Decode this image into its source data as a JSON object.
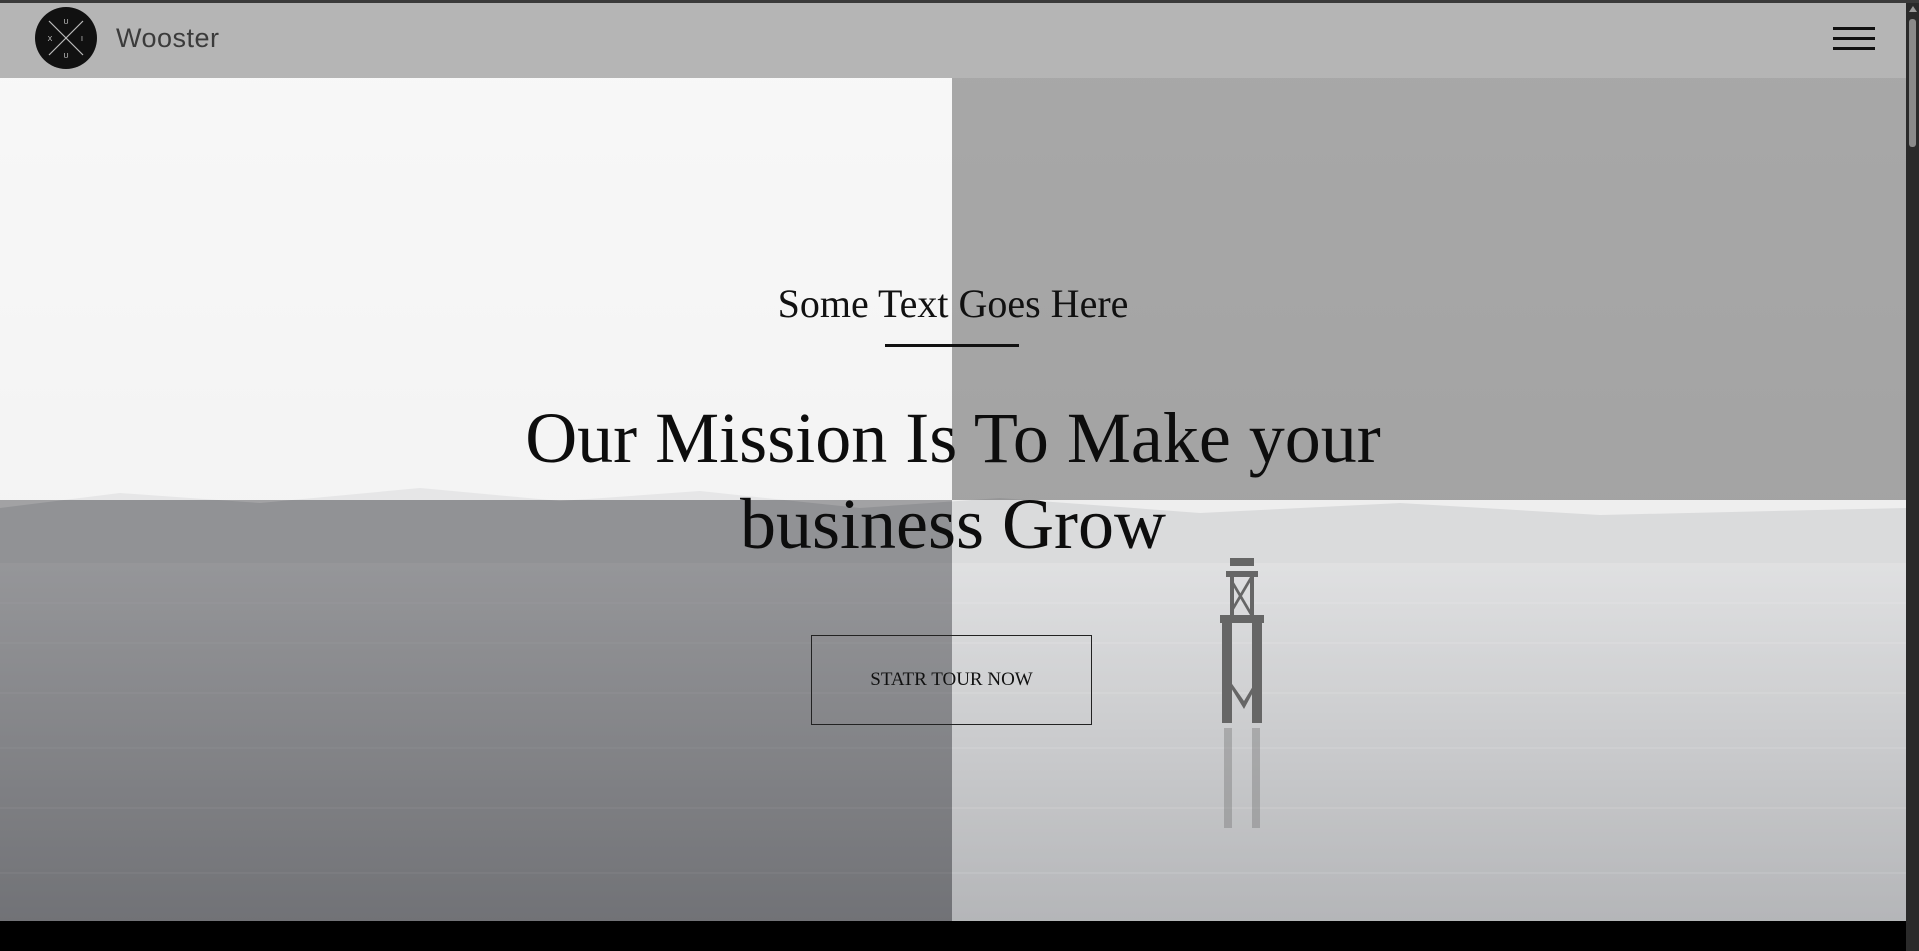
{
  "header": {
    "brand": "Wooster",
    "logo_icon": "compass-cross-logo",
    "menu_icon": "hamburger-menu-icon"
  },
  "hero": {
    "kicker": "Some Text Goes Here",
    "headline": "Our Mission Is To Make your business Grow",
    "cta_label": "STATR TOUR NOW"
  },
  "colors": {
    "header_bg": "#b5b5b5",
    "text": "#111111",
    "frame": "#000000"
  }
}
